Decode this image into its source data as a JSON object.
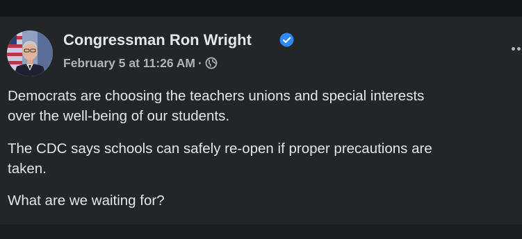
{
  "post": {
    "author": "Congressman Ron Wright",
    "timestamp": "February 5 at 11:26 AM",
    "meta_separator": "·",
    "audience_icon": "globe-icon",
    "verified_icon": "verified-badge-icon",
    "more_icon": "more-options-icon",
    "paragraphs": [
      {
        "lines": [
          "Democrats are choosing the teachers unions and special interests",
          "over the well-being of our students."
        ]
      },
      {
        "lines": [
          "The CDC says schools can safely re-open if proper precautions are",
          "taken."
        ]
      },
      {
        "lines": [
          "What are we waiting for?"
        ]
      }
    ]
  },
  "colors": {
    "background": "#18191a",
    "card": "#242526",
    "primary_text": "#e4e6eb",
    "secondary_text": "#b0b3b8",
    "verified_blue": "#2d88ff"
  }
}
